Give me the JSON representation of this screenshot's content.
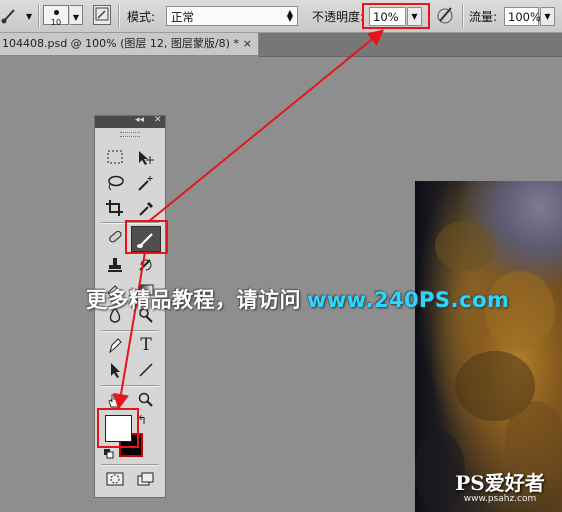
{
  "options_bar": {
    "brush_size": "10",
    "mode_label": "模式:",
    "mode_value": "正常",
    "opacity_label": "不透明度:",
    "opacity_value": "10%",
    "flow_label": "流量:",
    "flow_value": "100%"
  },
  "document_tab": {
    "title": "104408.psd @ 100% (图层 12, 图层蒙版/8) *",
    "close_glyph": "×"
  },
  "toolbox": {
    "collapse_glyph": "◂◂",
    "close_glyph": "✕",
    "type_tool_glyph": "T",
    "active_tool": "brush-tool",
    "foreground_color": "#ffffff",
    "background_color": "#000000"
  },
  "watermark": {
    "text": "更多精品教程，请访问",
    "url": "www.240PS.com"
  },
  "logo": {
    "text": "PS爱好者",
    "url": "www.psahz.com"
  },
  "highlight_color": "#e8141c"
}
